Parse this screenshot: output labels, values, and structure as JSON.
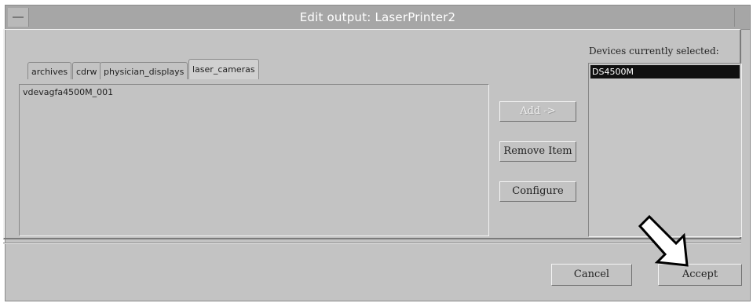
{
  "window": {
    "title": "Edit output: LaserPrinter2"
  },
  "tabs": [
    {
      "label": "archives",
      "active": false
    },
    {
      "label": "cdrw",
      "active": false
    },
    {
      "label": "physician_displays",
      "active": false
    },
    {
      "label": "laser_cameras",
      "active": true
    }
  ],
  "list": {
    "items": [
      "vdevagfa4500M_001"
    ]
  },
  "actions": {
    "add_label": "Add ->",
    "remove_label": "Remove Item",
    "configure_label": "Configure"
  },
  "devices": {
    "label": "Devices currently selected:",
    "items": [
      "DS4500M"
    ]
  },
  "footer": {
    "cancel_label": "Cancel",
    "accept_label": "Accept"
  },
  "icons": {
    "annotation": "pointer-arrow-icon"
  }
}
